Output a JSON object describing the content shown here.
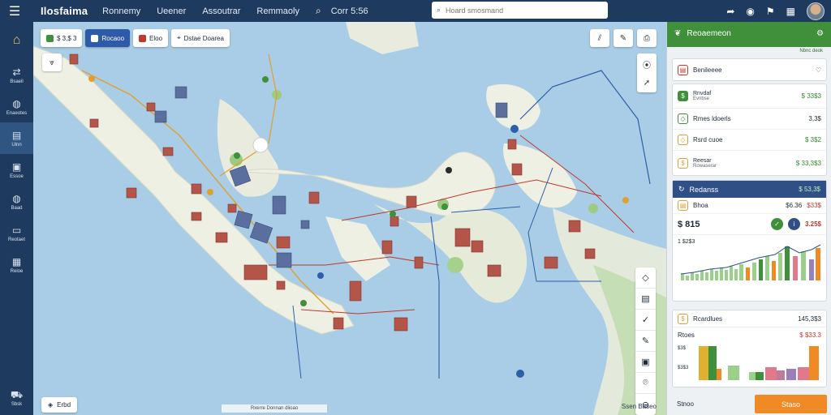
{
  "app": {
    "brand": "Ilosfaima",
    "nav": [
      "Ronnemy",
      "Ueener",
      "Assoutrar",
      "Remmaoly",
      "Corr 5:56"
    ],
    "search_placeholder": "Hoard smosmand"
  },
  "left_rail": {
    "items": [
      {
        "label": "Bsaeil",
        "icon": "route-icon"
      },
      {
        "label": "Enaeotes",
        "icon": "globe-icon"
      },
      {
        "label": "Ulnn",
        "icon": "map-icon"
      },
      {
        "label": "Essoe",
        "icon": "briefcase-icon"
      },
      {
        "label": "Baad",
        "icon": "globe-icon"
      },
      {
        "label": "Reotaet",
        "icon": "folder-icon"
      },
      {
        "label": "Reioe",
        "icon": "grid-icon"
      }
    ],
    "bottom_label": "Sbsk"
  },
  "map": {
    "chips": [
      {
        "label": "$ 3,$ 3",
        "color": "#3f8f3b"
      },
      {
        "label": "Rocaoo",
        "color": "#ffffff"
      },
      {
        "label": "Eloo",
        "color": "#c0392b"
      },
      {
        "label": "Dstae Doarea",
        "color": "#333333"
      }
    ],
    "legend_label": "Erbd",
    "scale_text": "Rxerre  Donnan dlioao",
    "attribution": "Ssen Baseo"
  },
  "panel": {
    "title": "Reoaemeon",
    "sub": "Nbnc deok",
    "section1": {
      "label": "Benileeee"
    },
    "rows": [
      {
        "label": "Rnvdaf",
        "sublabel": "Evnbse",
        "value": "$ 33$3"
      },
      {
        "label": "Rmes ldoerls",
        "value": "3,3$"
      },
      {
        "label": "Rsrd cuoe",
        "value": "$ 3$2"
      },
      {
        "label": "Reesar",
        "sublabel": "Rowaserar",
        "value": "$ 33,3$3"
      }
    ],
    "section2": {
      "title": "Redanss",
      "value": "$ 53,3$",
      "row_label": "Bhoa",
      "row_val1": "$6.36",
      "row_val2": "$33$",
      "big_value": "$ 815",
      "big_value2": "3.25$",
      "chart_label": "1 $2$3"
    },
    "section3": {
      "title": "Rcardlues",
      "value": "145,3$3",
      "row_label": "Rtoes",
      "row_value": "$ $33.3",
      "y_labels": [
        "$3$",
        "$3$3"
      ]
    },
    "footer_label": "Stnoo",
    "action_button": "Staso"
  },
  "colors": {
    "topbar": "#1f3a5f",
    "accent_green": "#3f8f3b",
    "accent_blue": "#2f4f86",
    "accent_orange": "#f08a24"
  }
}
